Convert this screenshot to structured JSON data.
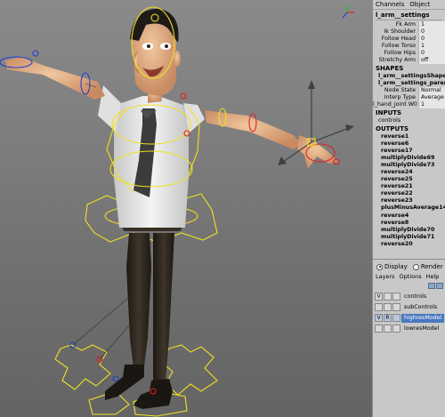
{
  "channel_box": {
    "menu": [
      "Channels",
      "Object"
    ],
    "object_name": "l_arm__settings",
    "attributes": [
      {
        "name": "Fk Arm",
        "value": "1"
      },
      {
        "name": "Ik Shoulder",
        "value": "0"
      },
      {
        "name": "Follow Head",
        "value": "0"
      },
      {
        "name": "Follow Torso",
        "value": "1"
      },
      {
        "name": "Follow Hips",
        "value": "0"
      },
      {
        "name": "Stretchy Arm",
        "value": "off"
      }
    ],
    "shapes_header": "SHAPES",
    "shapes": [
      "l_arm__settingsShape",
      "l_arm__settings_parentC"
    ],
    "shape_attributes": [
      {
        "name": "Node State",
        "value": "Normal"
      },
      {
        "name": "Interp Type",
        "value": "Average"
      }
    ],
    "joint_row": {
      "name": "l_hand_joint W0",
      "value": "1"
    },
    "inputs_header": "INPUTS",
    "inputs": [
      "controls"
    ],
    "outputs_header": "OUTPUTS",
    "outputs": [
      "reverse1",
      "reverse6",
      "reverse17",
      "multiplyDivide69",
      "multiplyDivide73",
      "reverse24",
      "reverse25",
      "reverse21",
      "reverse22",
      "reverse23",
      "plusMinusAverage14",
      "reverse4",
      "reverse8",
      "multiplyDivide70",
      "multiplyDivide71",
      "reverse20"
    ]
  },
  "layer_editor": {
    "display_label": "Display",
    "render_label": "Render",
    "menu": [
      "Layers",
      "Options",
      "Help"
    ],
    "layers": [
      {
        "v": "V",
        "p": "",
        "name": "controls",
        "selected": false
      },
      {
        "v": "",
        "p": "",
        "name": "subControls",
        "selected": false
      },
      {
        "v": "V",
        "p": "R",
        "name": "highresModel",
        "selected": true
      },
      {
        "v": "",
        "p": "",
        "name": "lowresModel",
        "selected": false
      }
    ]
  },
  "colors": {
    "viewport_bg": "#7d7d7d",
    "skin": "#e3b08a",
    "shirt": "#ebebeb",
    "pants": "#2a241c",
    "control_yellow": "#f0e020",
    "control_red": "#e02020",
    "control_blue": "#2040d0",
    "selection_highlight": "#4a78c0"
  },
  "icons": [
    "view-axis-gizmo-icon",
    "move-manipulator-icon"
  ]
}
